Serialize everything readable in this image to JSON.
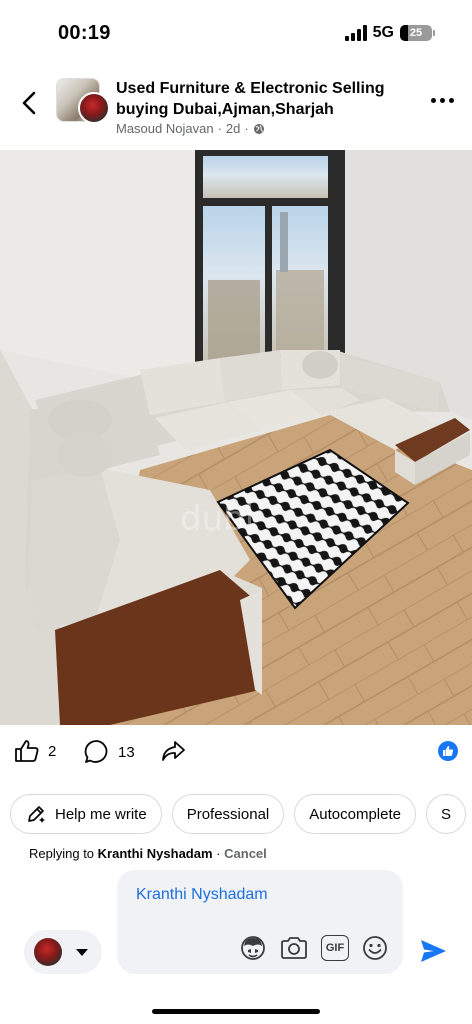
{
  "status_bar": {
    "time": "00:19",
    "network": "5G",
    "battery_percent": "25",
    "battery_level": 0.25
  },
  "post": {
    "group_name": "Used Furniture & Electronic Selling buying Dubai,Ajman,Sharjah",
    "author": "Masoud Nojavan",
    "separator": "·",
    "age": "2d",
    "privacy_icon": "globe-icon",
    "photo_watermark": "dubi"
  },
  "actions": {
    "like_count": "2",
    "comment_count": "13"
  },
  "ai_chips": [
    {
      "label": "Help me write",
      "icon": "pencil-sparkle-icon"
    },
    {
      "label": "Professional"
    },
    {
      "label": "Autocomplete"
    },
    {
      "label": "S"
    }
  ],
  "reply": {
    "prefix": "Replying to",
    "name": "Kranthi Nyshadam",
    "separator": "·",
    "cancel": "Cancel"
  },
  "composer": {
    "mention": "Kranthi Nyshadam",
    "icons": [
      "avatar-sticker-icon",
      "camera-icon",
      "gif-icon",
      "emoji-icon"
    ],
    "gif_label": "GIF"
  },
  "colors": {
    "accent": "#1877f2",
    "mention": "#1b6fe0",
    "secondary_text": "#65676b"
  }
}
